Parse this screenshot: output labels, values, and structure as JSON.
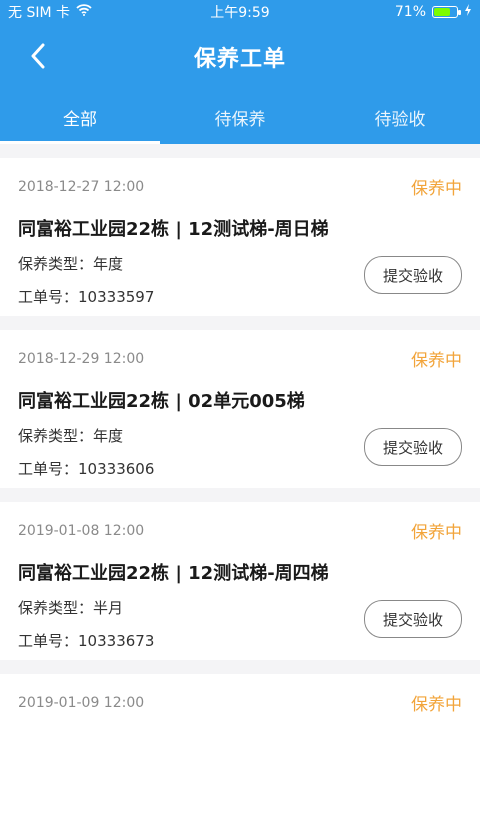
{
  "status_bar": {
    "carrier": "无 SIM 卡",
    "time": "上午9:59",
    "battery": "71%",
    "battery_level": 0.71
  },
  "header": {
    "title": "保养工单"
  },
  "tabs": [
    {
      "label": "全部",
      "active": true
    },
    {
      "label": "待保养",
      "active": false
    },
    {
      "label": "待验收",
      "active": false
    }
  ],
  "labels": {
    "type_label": "保养类型：",
    "order_label": "工单号：",
    "submit_label": "提交验收"
  },
  "orders": [
    {
      "time": "2018-12-27 12:00",
      "status": "保养中",
      "name": "同富裕工业园22栋 | 12测试梯-周日梯",
      "type": "年度",
      "order_no": "10333597"
    },
    {
      "time": "2018-12-29 12:00",
      "status": "保养中",
      "name": "同富裕工业园22栋 | 02单元005梯",
      "type": "年度",
      "order_no": "10333606"
    },
    {
      "time": "2019-01-08 12:00",
      "status": "保养中",
      "name": "同富裕工业园22栋 | 12测试梯-周四梯",
      "type": "半月",
      "order_no": "10333673"
    },
    {
      "time": "2019-01-09 12:00",
      "status": "保养中"
    }
  ],
  "colors": {
    "primary": "#2f9bea",
    "status": "#f2a43a"
  }
}
